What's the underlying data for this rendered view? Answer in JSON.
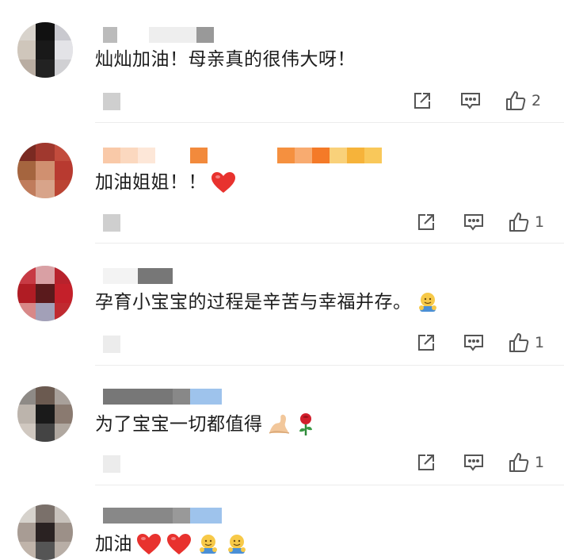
{
  "comments": [
    {
      "text": "灿灿加油！母亲真的很伟大呀！",
      "emojis": [],
      "like_count": "2"
    },
    {
      "text": "加油姐姐！！",
      "emojis": [
        "heart"
      ],
      "like_count": "1"
    },
    {
      "text": "孕育小宝宝的过程是辛苦与幸福并存。",
      "emojis": [
        "hug"
      ],
      "like_count": "1"
    },
    {
      "text": "为了宝宝一切都值得",
      "emojis": [
        "flex",
        "rose"
      ],
      "like_count": "1"
    },
    {
      "text": "加油",
      "emojis": [
        "heart",
        "heart",
        "hug",
        "hug"
      ],
      "like_count": ""
    }
  ],
  "icons": {
    "share": "share-icon",
    "comment": "comment-icon",
    "like": "thumbs-up-icon"
  },
  "colors": {
    "text": "#1c1c1c",
    "icon": "#555555",
    "heart": "#e8322e",
    "divider": "#ececec"
  }
}
